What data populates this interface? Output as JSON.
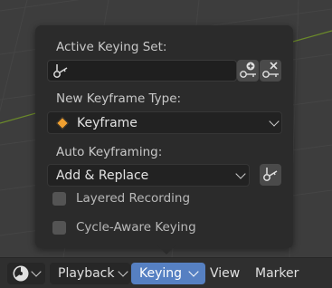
{
  "popover": {
    "active_keying_set_label": "Active Keying Set:",
    "active_keying_set_value": "",
    "new_keyframe_type_label": "New Keyframe Type:",
    "new_keyframe_type_value": "Keyframe",
    "auto_keyframing_label": "Auto Keyframing:",
    "auto_keyframing_value": "Add & Replace",
    "layered_recording_label": "Layered Recording",
    "layered_recording_checked": false,
    "cycle_aware_keying_label": "Cycle-Aware Keying",
    "cycle_aware_keying_checked": false
  },
  "header": {
    "menus": [
      "Playback",
      "Keying",
      "View",
      "Marker"
    ],
    "active_menu": "Keying"
  },
  "colors": {
    "keyframe_diamond": "#f0a030",
    "active_menu_bg": "#5680c2",
    "grid_axis": "#6b8a2a"
  }
}
